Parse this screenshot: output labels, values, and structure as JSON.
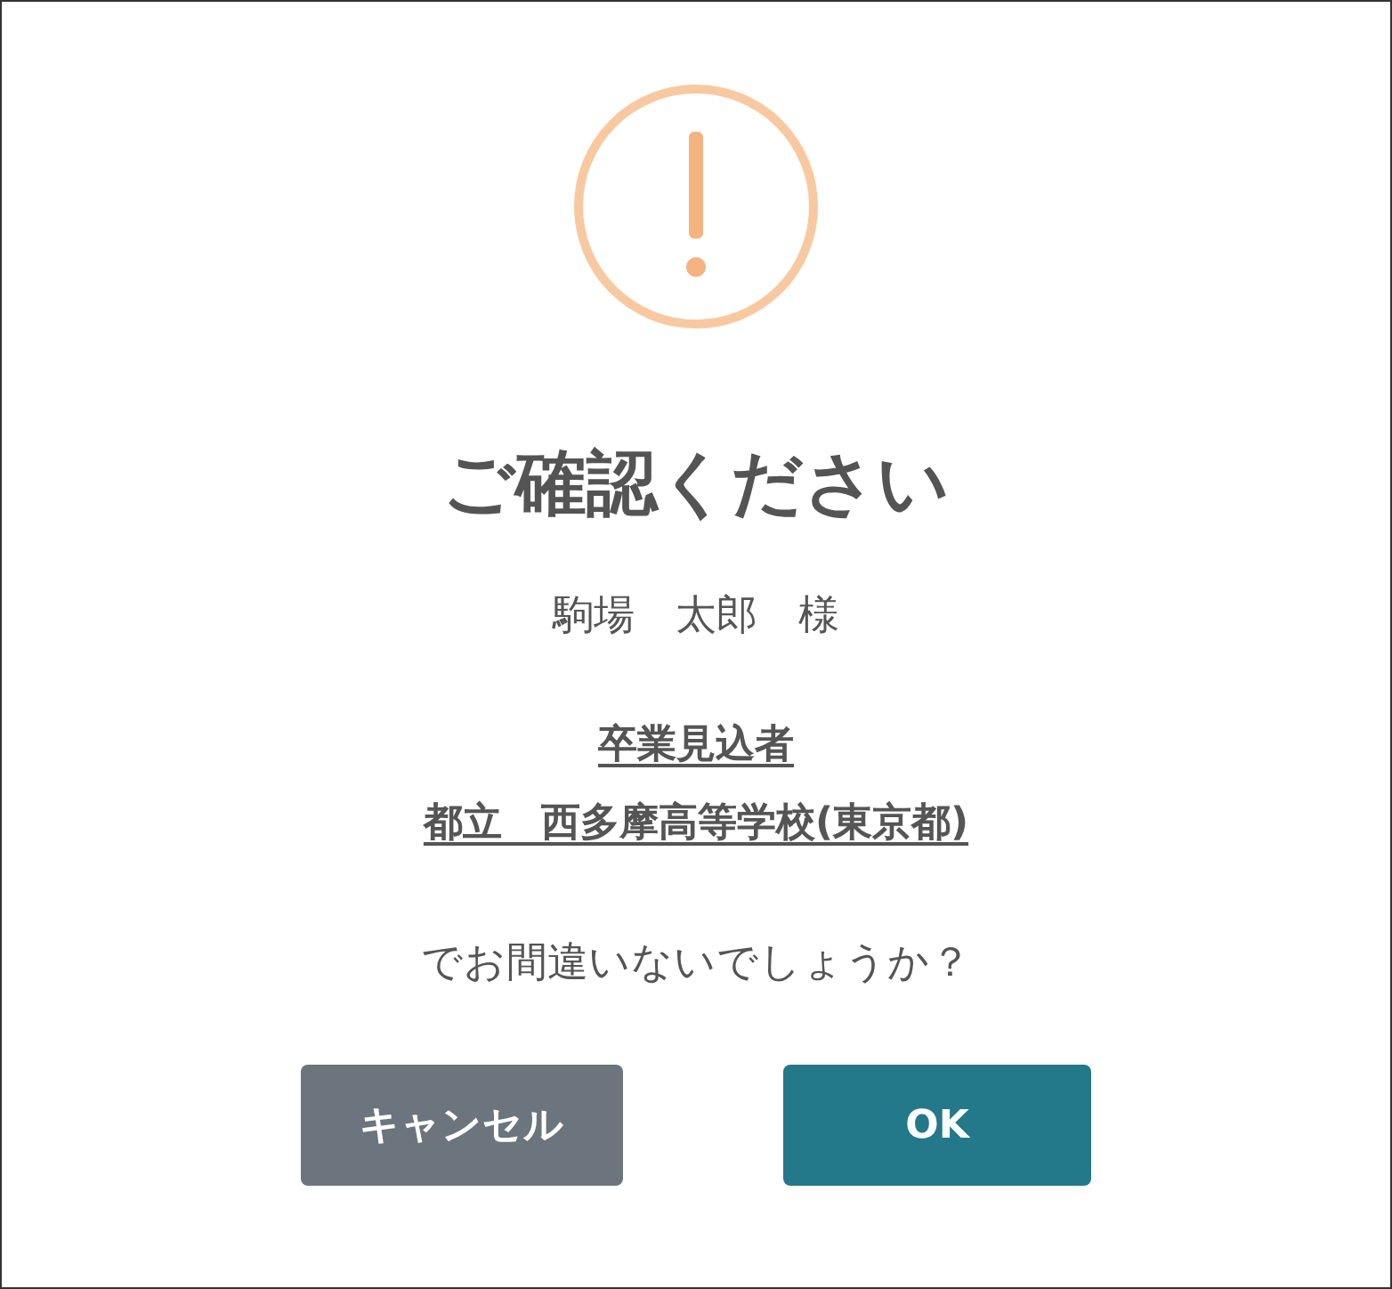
{
  "dialog": {
    "title": "ご確認ください",
    "recipient": "駒場　太郎　様",
    "emphasis_lines": [
      "卒業見込者",
      "都立　西多摩高等学校(東京都)"
    ],
    "question": "でお間違いないでしょうか？",
    "buttons": [
      {
        "label": "キャンセル",
        "kind": "secondary"
      },
      {
        "label": "OK",
        "kind": "primary"
      }
    ]
  }
}
